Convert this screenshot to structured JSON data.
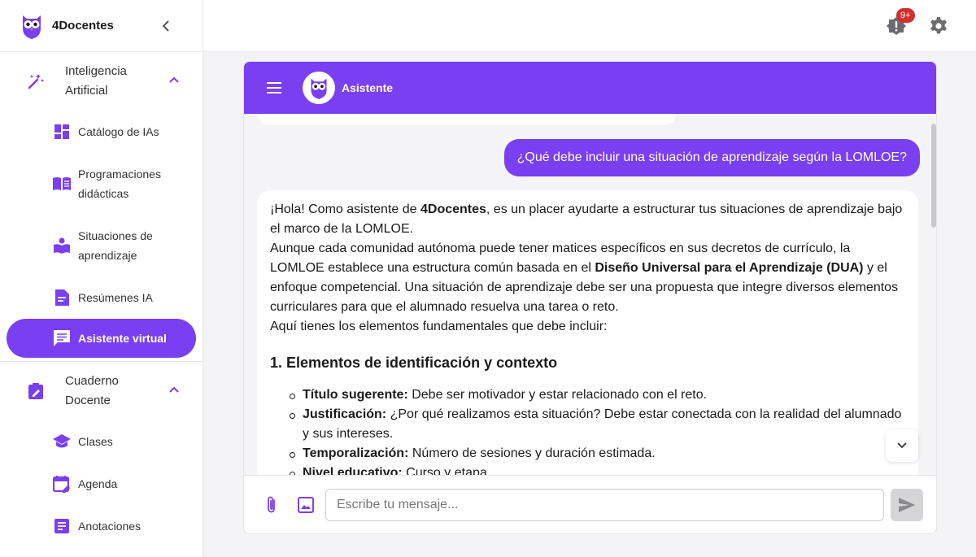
{
  "brand": {
    "name": "4Docentes"
  },
  "sidebar": {
    "groups": [
      {
        "label": "Inteligencia Artificial",
        "items": [
          {
            "label": "Catálogo de IAs",
            "icon": "dashboard-icon"
          },
          {
            "label": "Programaciones didácticas",
            "icon": "book-icon"
          },
          {
            "label": "Situaciones de aprendizaje",
            "icon": "reader-icon"
          },
          {
            "label": "Resúmenes IA",
            "icon": "summary-icon"
          },
          {
            "label": "Asistente virtual",
            "icon": "chat-icon",
            "active": true
          }
        ]
      },
      {
        "label": "Cuaderno Docente",
        "items": [
          {
            "label": "Clases",
            "icon": "school-icon"
          },
          {
            "label": "Agenda",
            "icon": "calendar-icon"
          },
          {
            "label": "Anotaciones",
            "icon": "notes-icon"
          }
        ]
      }
    ]
  },
  "topbar": {
    "notification_count": "9+"
  },
  "chat": {
    "title": "Asistente",
    "user_message": "¿Qué debe incluir una situación de aprendizaje según la LOMLOE?",
    "bot": {
      "p1_a": "¡Hola! Como asistente de ",
      "p1_b": "4Docentes",
      "p1_c": ", es un placer ayudarte a estructurar tus situaciones de aprendizaje bajo el marco de la LOMLOE.",
      "p2_a": "Aunque cada comunidad autónoma puede tener matices específicos en sus decretos de currículo, la LOMLOE establece una estructura común basada en el ",
      "p2_b": "Diseño Universal para el Aprendizaje (DUA)",
      "p2_c": " y el enfoque competencial. Una situación de aprendizaje debe ser una propuesta que integre diversos elementos curriculares para que el alumnado resuelva una tarea o reto.",
      "p3": "Aquí tienes los elementos fundamentales que debe incluir:",
      "heading": "1. Elementos de identificación y contexto",
      "items": [
        {
          "term": "Título sugerente:",
          "text": " Debe ser motivador y estar relacionado con el reto."
        },
        {
          "term": "Justificación:",
          "text": " ¿Por qué realizamos esta situación? Debe estar conectada con la realidad del alumnado y sus intereses."
        },
        {
          "term": "Temporalización:",
          "text": " Número de sesiones y duración estimada."
        },
        {
          "term": "Nivel educativo:",
          "text": " Curso y etapa."
        }
      ]
    },
    "input_placeholder": "Escribe tu mensaje..."
  },
  "colors": {
    "accent": "#7a3ff0",
    "badge": "#d32f2f"
  }
}
